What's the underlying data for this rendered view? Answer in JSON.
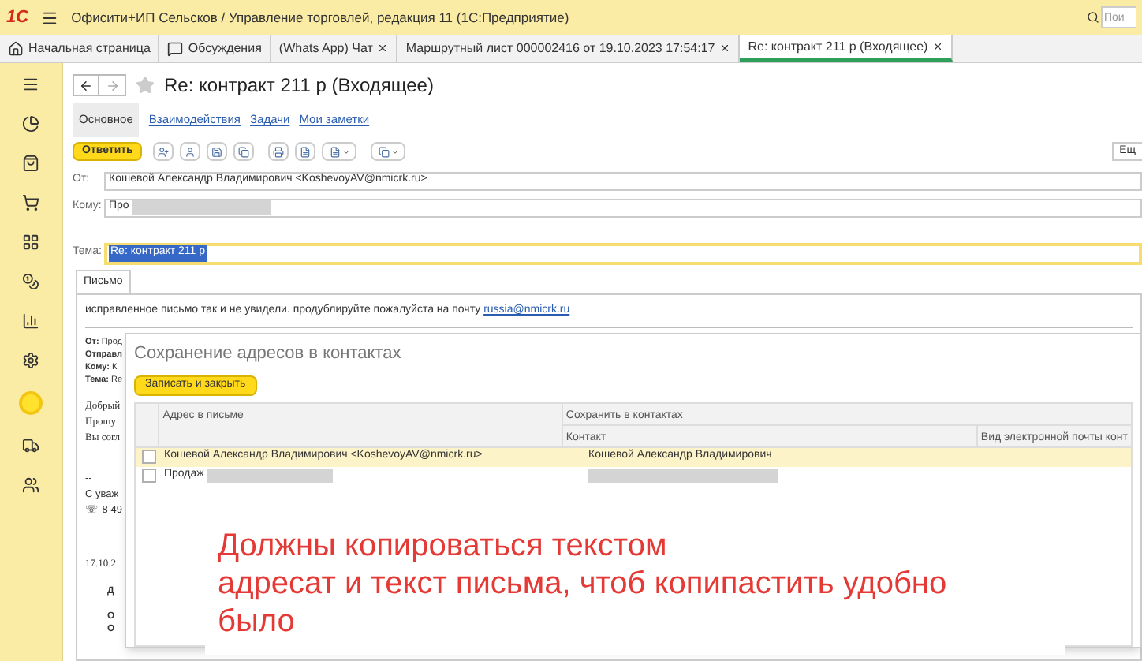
{
  "app": {
    "logo": "1С",
    "title": "Офисити+ИП Сельсков / Управление торговлей, редакция 11  (1С:Предприятие)",
    "search": {
      "placeholder": "Пои"
    }
  },
  "tabs": [
    {
      "label": "Начальная страница",
      "kind": "home",
      "selected": false
    },
    {
      "label": "Обсуждения",
      "kind": "chat",
      "selected": false
    },
    {
      "label": "(Whats App) Чат",
      "kind": "plain",
      "selected": false
    },
    {
      "label": "Маршрутный лист 000002416 от 19.10.2023 17:54:17",
      "kind": "plain",
      "selected": false
    },
    {
      "label": "Re: контракт 211 р (Входящее)",
      "kind": "plain",
      "selected": true
    }
  ],
  "document": {
    "title": "Re: контракт 211 р (Входящее)",
    "sections": [
      {
        "label": "Основное",
        "selected": true
      },
      {
        "label": "Взаимодействия",
        "selected": false
      },
      {
        "label": "Задачи",
        "selected": false
      },
      {
        "label": "Мои заметки",
        "selected": false
      }
    ],
    "reply_button": "Ответить",
    "more_button": "Ещ",
    "from": {
      "label": "От:",
      "value": "Кошевой Александр Владимирович <KoshevoyAV@nmicrk.ru>"
    },
    "to": {
      "label": "Кому:",
      "value": "Про",
      "redacted": true
    },
    "subject": {
      "label": "Тема:",
      "value": "Re: контракт 211 р"
    },
    "body_tab": "Письмо",
    "body": {
      "text": "исправленное письмо так и не увидели. продублируйте пожалуйста на почту",
      "link": "russia@nmicrk.ru",
      "fragments": [
        {
          "kind": "header",
          "text": "**От:** Прод"
        },
        {
          "kind": "header",
          "text": "**Отправл**"
        },
        {
          "kind": "header",
          "text": "**Кому:** К"
        },
        {
          "kind": "header",
          "text": "**Тема:** Re"
        },
        {
          "kind": "gap"
        },
        {
          "kind": "serif",
          "text": "Добрый"
        },
        {
          "kind": "serif",
          "text": "Прошу"
        },
        {
          "kind": "serif",
          "text": "Вы согл"
        },
        {
          "kind": "gap"
        },
        {
          "kind": "gap"
        },
        {
          "kind": "plain",
          "text": "--"
        },
        {
          "kind": "plain",
          "text": "С уваж"
        },
        {
          "kind": "plain",
          "text": "☏ 8 49"
        },
        {
          "kind": "gap"
        },
        {
          "kind": "gap"
        },
        {
          "kind": "gap"
        },
        {
          "kind": "serif",
          "text": "17.10.2"
        },
        {
          "kind": "gap"
        },
        {
          "kind": "indent",
          "text": "Д"
        },
        {
          "kind": "gap"
        },
        {
          "kind": "indent",
          "text": "О"
        },
        {
          "kind": "indent",
          "text": "О"
        }
      ]
    }
  },
  "dialog": {
    "title": "Сохранение адресов в контактах",
    "save_button": "Записать и закрыть",
    "columns": {
      "address": "Адрес в письме",
      "group": "Сохранить в контактах",
      "contact": "Контакт",
      "email_kind": "Вид электронной почты конт"
    },
    "rows": [
      {
        "address": "Кошевой Александр Владимирович <KoshevoyAV@nmicrk.ru>",
        "contact": "Кошевой Александр Владимирович",
        "selected": true,
        "checked": false,
        "redacted": false
      },
      {
        "address": "Продаж",
        "contact": "",
        "selected": false,
        "checked": false,
        "redacted": true
      }
    ]
  },
  "annotation": {
    "lines": [
      "Должны копироваться текстом",
      "адресат и текст письма, чтоб копипастить удобно",
      "было"
    ]
  }
}
